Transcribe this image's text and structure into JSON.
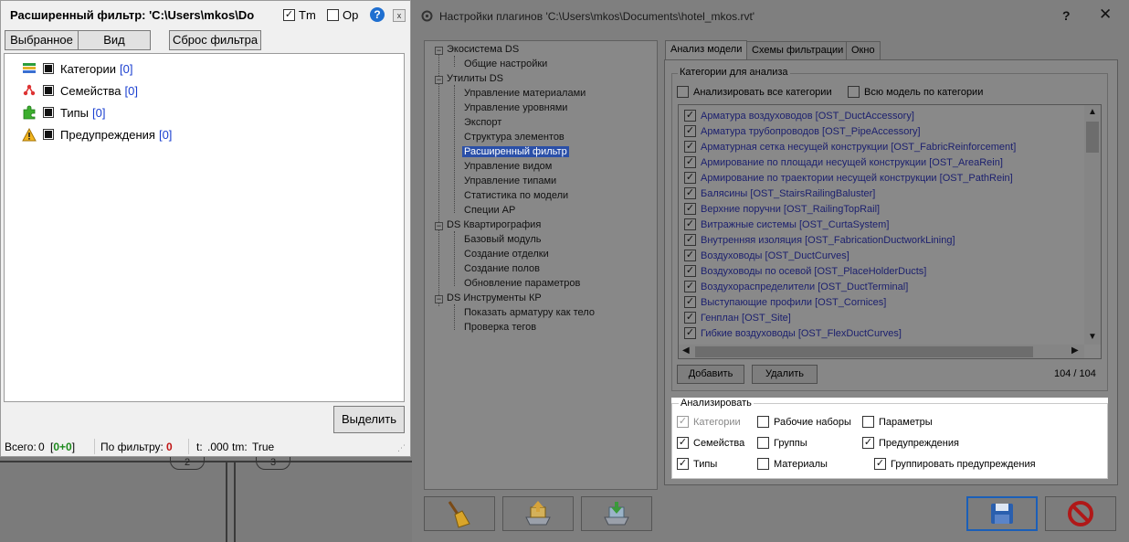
{
  "filter_window": {
    "title": "Расширенный фильтр: 'C:\\Users\\mkos\\Do",
    "tm_label": "Tm",
    "tm_checked": true,
    "op_label": "Op",
    "op_checked": false,
    "help_icon": "help-icon",
    "close_label": "x",
    "buttons": {
      "selected": "Выбранное",
      "view": "Вид",
      "reset": "Сброс фильтра"
    },
    "tree": [
      {
        "label": "Категории",
        "count": "[0]",
        "icon": "categories-icon"
      },
      {
        "label": "Семейства",
        "count": "[0]",
        "icon": "families-icon"
      },
      {
        "label": "Типы",
        "count": "[0]",
        "icon": "types-icon"
      },
      {
        "label": "Предупреждения",
        "count": "[0]",
        "icon": "warning-icon"
      }
    ],
    "select_button": "Выделить",
    "status": {
      "total_label": "Всего:",
      "total_value": "0",
      "total_breakdown_open": "[",
      "total_breakdown_a": "0",
      "total_breakdown_plus": "+",
      "total_breakdown_b": "0",
      "total_breakdown_close": "]",
      "by_filter_label": "По фильтру:",
      "by_filter_value": "0",
      "t_label": "t:",
      "t_value": ".000",
      "tm_label": "tm:",
      "tm_value": "True"
    }
  },
  "background": {
    "tags": [
      "2",
      "3"
    ]
  },
  "settings_dialog": {
    "title": "Настройки плагинов 'C:\\Users\\mkos\\Documents\\hotel_mkos.rvt'",
    "help_label": "?",
    "close_label": "✕",
    "tree": {
      "groups": [
        {
          "label": "Экосистема DS",
          "items": [
            "Общие настройки"
          ]
        },
        {
          "label": "Утилиты DS",
          "items": [
            "Управление материалами",
            "Управление уровнями",
            "Экспорт",
            "Структура элементов",
            "Расширенный фильтр",
            "Управление видом",
            "Управление типами",
            "Статистика по модели",
            "Специи АР"
          ]
        },
        {
          "label": "DS Квартирография",
          "items": [
            "Базовый модуль",
            "Создание отделки",
            "Создание полов",
            "Обновление параметров"
          ]
        },
        {
          "label": "DS Инструменты КР",
          "items": [
            "Показать арматуру как тело",
            "Проверка тегов"
          ]
        }
      ],
      "selected": "Расширенный фильтр"
    },
    "tabs": [
      "Анализ модели",
      "Схемы фильтрации",
      "Окно"
    ],
    "active_tab": "Анализ модели",
    "categories_group": "Категории для анализа",
    "analyze_all_label": "Анализировать все категории",
    "analyze_all_checked": false,
    "whole_model_label": "Всю модель по категории",
    "whole_model_checked": false,
    "categories": [
      "Арматура воздуховодов [OST_DuctAccessory]",
      "Арматура трубопроводов [OST_PipeAccessory]",
      "Арматурная сетка несущей конструкции [OST_FabricReinforcement]",
      "Армирование по площади несущей конструкции [OST_AreaRein]",
      "Армирование по траектории несущей конструкции [OST_PathRein]",
      "Балясины [OST_StairsRailingBaluster]",
      "Верхние поручни [OST_RailingTopRail]",
      "Витражные системы [OST_CurtaSystem]",
      "Внутренняя изоляция [OST_FabricationDuctworkLining]",
      "Воздуховоды [OST_DuctCurves]",
      "Воздуховоды по осевой [OST_PlaceHolderDucts]",
      "Воздухораспределители [OST_DuctTerminal]",
      "Выступающие профили [OST_Cornices]",
      "Генплан [OST_Site]",
      "Гибкие воздуховоды [OST_FlexDuctCurves]"
    ],
    "add_button": "Добавить",
    "remove_button": "Удалить",
    "count_text": "104 / 104",
    "analyze_group": "Анализировать",
    "analyze_options": [
      {
        "label": "Категории",
        "checked": true,
        "disabled": true
      },
      {
        "label": "Рабочие наборы",
        "checked": false
      },
      {
        "label": "Параметры",
        "checked": false
      },
      {
        "label": "Семейства",
        "checked": true
      },
      {
        "label": "Группы",
        "checked": false
      },
      {
        "label": "Предупреждения",
        "checked": true
      },
      {
        "label": "Типы",
        "checked": true
      },
      {
        "label": "Материалы",
        "checked": false
      },
      {
        "label": "Группировать предупреждения",
        "checked": true
      }
    ],
    "bottom_buttons": [
      "broom-icon",
      "import-settings-icon",
      "export-settings-icon",
      "save-icon",
      "cancel-icon"
    ]
  }
}
